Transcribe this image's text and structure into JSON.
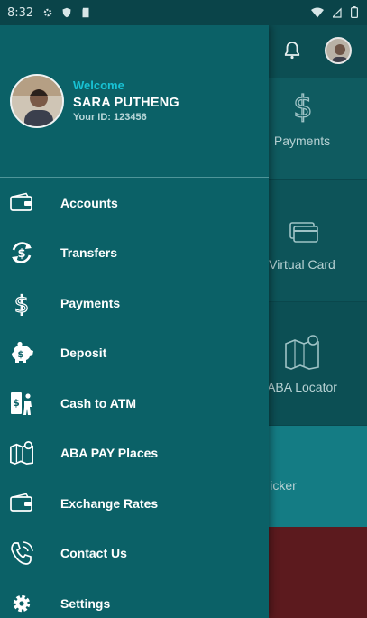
{
  "status_bar": {
    "time": "8:32"
  },
  "profile": {
    "welcome": "Welcome",
    "name": "SARA PUTHENG",
    "user_id": "Your ID: 123456"
  },
  "menu": [
    {
      "label": "Accounts",
      "icon": "wallet-icon"
    },
    {
      "label": "Transfers",
      "icon": "transfer-icon"
    },
    {
      "label": "Payments",
      "icon": "dollar-icon"
    },
    {
      "label": "Deposit",
      "icon": "piggy-bank-icon"
    },
    {
      "label": "Cash to ATM",
      "icon": "atm-icon"
    },
    {
      "label": "ABA PAY Places",
      "icon": "map-pin-icon"
    },
    {
      "label": "Exchange Rates",
      "icon": "wallet-icon"
    },
    {
      "label": "Contact Us",
      "icon": "phone-icon"
    },
    {
      "label": "Settings",
      "icon": "gear-icon"
    }
  ],
  "background_tiles": {
    "payments": "Payments",
    "virtual_card": "Virtual Card",
    "locator": "ABA Locator",
    "sticker": "icker"
  },
  "colors": {
    "drawer": "#0b6167",
    "accent": "#18c2d4",
    "text": "#ffffff"
  }
}
